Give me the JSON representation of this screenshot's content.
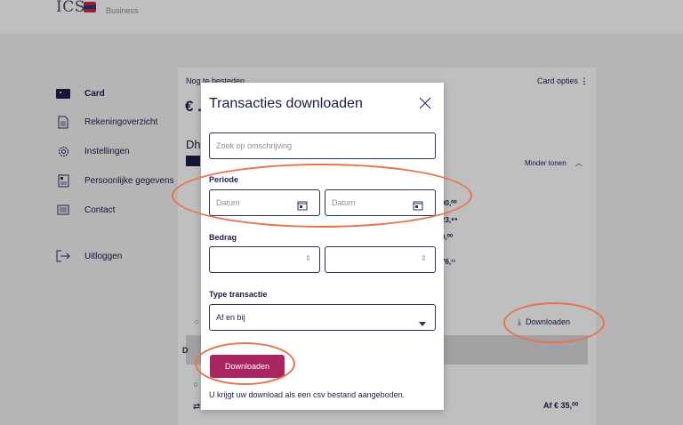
{
  "header": {
    "logo_text": "ICS",
    "subtitle": "Business"
  },
  "sidebar": {
    "items": [
      {
        "label": "Card",
        "icon": "card-icon",
        "active": true
      },
      {
        "label": "Rekeningoverzicht",
        "icon": "document-icon",
        "active": false
      },
      {
        "label": "Instellingen",
        "icon": "gear-icon",
        "active": false
      },
      {
        "label": "Persoonlijke gegevens",
        "icon": "id-card-icon",
        "active": false
      },
      {
        "label": "Contact",
        "icon": "chat-icon",
        "active": false
      },
      {
        "label": "Uitloggen",
        "icon": "logout-icon",
        "active": false
      }
    ]
  },
  "main": {
    "spend_label": "Nog te besteden",
    "amount_prefix": "€ .",
    "card_options": "Card opties",
    "card_name_fragment": "Dhi",
    "less_label": "Minder tonen",
    "values": [
      "00,⁰⁰",
      "23,⁸⁹",
      "0,⁰⁰",
      "76,¹¹"
    ],
    "download_link": "Downloaden",
    "row_fragment": "D",
    "date_fragment": "0",
    "amount_row": "Af € 35,⁰⁰"
  },
  "modal": {
    "title": "Transacties downloaden",
    "search_placeholder": "Zoek op omschrijving",
    "periode_label": "Periode",
    "date_from_placeholder": "Datum",
    "date_to_placeholder": "Datum",
    "bedrag_label": "Bedrag",
    "type_label": "Type transactie",
    "type_value": "Af en bij",
    "download_button": "Downloaden",
    "hint": "U krijgt uw download als een csv bestand aangeboden."
  },
  "colors": {
    "primary": "#a8255f",
    "navy": "#1a1f4a",
    "annotation": "#e8734a"
  }
}
